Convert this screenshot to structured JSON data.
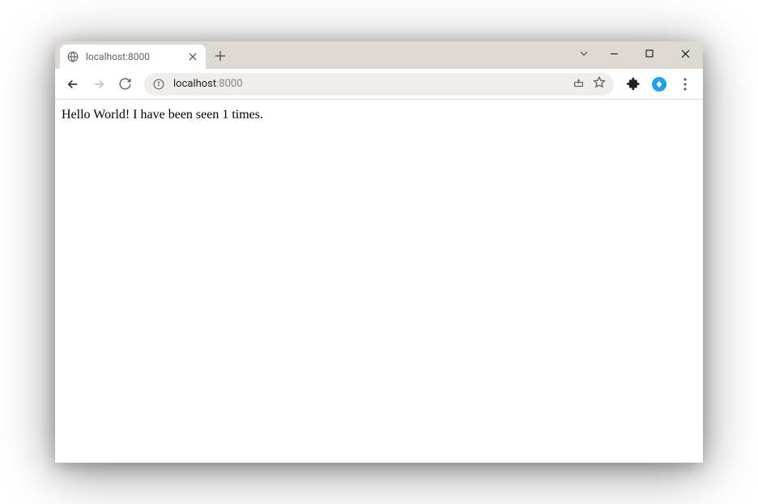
{
  "tab": {
    "title": "localhost:8000"
  },
  "omnibox": {
    "host": "localhost",
    "port": ":8000"
  },
  "page": {
    "body_text": "Hello World! I have been seen 1 times."
  }
}
